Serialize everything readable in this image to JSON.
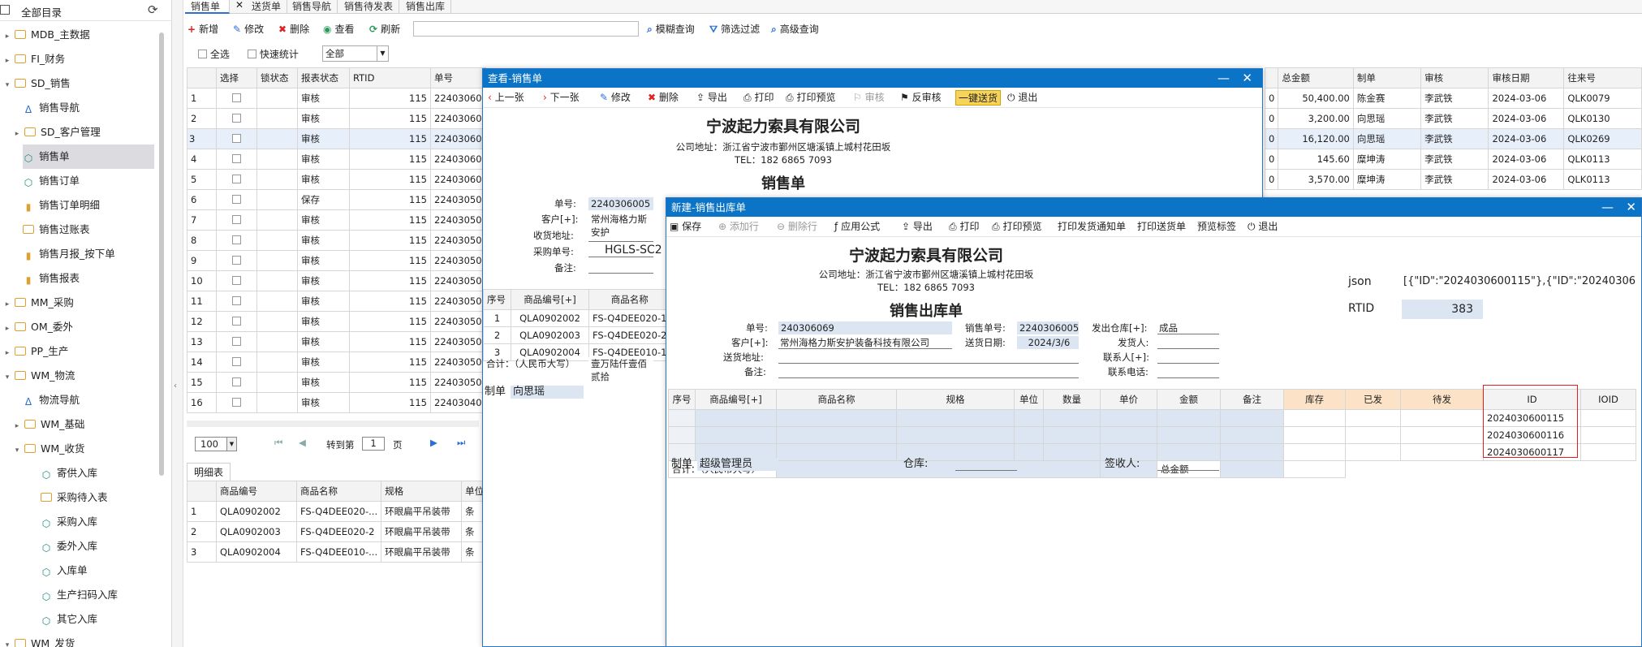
{
  "sidebar": {
    "title": "全部目录",
    "items": [
      {
        "label": "MDB_主数据",
        "icon": "folder",
        "arrow": "▸"
      },
      {
        "label": "FI_财务",
        "icon": "folder",
        "arrow": "▸"
      },
      {
        "label": "SD_销售",
        "icon": "folder",
        "arrow": "▾"
      },
      {
        "label": "销售导航",
        "icon": "triangle"
      },
      {
        "label": "SD_客户管理",
        "icon": "folder",
        "arrow": "▸"
      },
      {
        "label": "销售单",
        "icon": "cube",
        "selected": true
      },
      {
        "label": "销售订单",
        "icon": "cube"
      },
      {
        "label": "销售订单明细",
        "icon": "bar"
      },
      {
        "label": "销售过账表",
        "icon": "folder"
      },
      {
        "label": "销售月报_按下单",
        "icon": "bar"
      },
      {
        "label": "销售报表",
        "icon": "bar"
      },
      {
        "label": "MM_采购",
        "icon": "folder",
        "arrow": "▸"
      },
      {
        "label": "OM_委外",
        "icon": "folder",
        "arrow": "▸"
      },
      {
        "label": "PP_生产",
        "icon": "folder",
        "arrow": "▸"
      },
      {
        "label": "WM_物流",
        "icon": "folder",
        "arrow": "▾"
      },
      {
        "label": "物流导航",
        "icon": "triangle"
      },
      {
        "label": "WM_基础",
        "icon": "folder",
        "arrow": "▸"
      },
      {
        "label": "WM_收货",
        "icon": "folder",
        "arrow": "▾"
      },
      {
        "label": "寄供入库",
        "icon": "cube"
      },
      {
        "label": "采购待入表",
        "icon": "folder"
      },
      {
        "label": "采购入库",
        "icon": "cube"
      },
      {
        "label": "委外入库",
        "icon": "cube"
      },
      {
        "label": "入库单",
        "icon": "cube"
      },
      {
        "label": "生产扫码入库",
        "icon": "cube"
      },
      {
        "label": "其它入库",
        "icon": "cube"
      },
      {
        "label": "WM_发货",
        "icon": "folder",
        "arrow": "▾"
      }
    ]
  },
  "tabs": [
    "销售单",
    "送货单",
    "销售导航",
    "销售待发表",
    "销售出库"
  ],
  "toolbar": {
    "add": "新增",
    "edit": "修改",
    "delete": "删除",
    "view": "查看",
    "refresh": "刷新",
    "fuzzy": "模糊查询",
    "filter": "筛选过滤",
    "advanced": "高级查询",
    "select_all": "全选",
    "quick_stats": "快速统计",
    "scope": "全部"
  },
  "grid": {
    "headers": [
      "选择",
      "锁状态",
      "报表状态",
      "RTID",
      "单号"
    ],
    "rows": [
      {
        "n": "1",
        "status": "审核",
        "rtid": "115",
        "no": "22403060"
      },
      {
        "n": "2",
        "status": "审核",
        "rtid": "115",
        "no": "22403060"
      },
      {
        "n": "3",
        "status": "审核",
        "rtid": "115",
        "no": "22403060"
      },
      {
        "n": "4",
        "status": "审核",
        "rtid": "115",
        "no": "22403060"
      },
      {
        "n": "5",
        "status": "审核",
        "rtid": "115",
        "no": "22403060"
      },
      {
        "n": "6",
        "status": "保存",
        "rtid": "115",
        "no": "22403050"
      },
      {
        "n": "7",
        "status": "审核",
        "rtid": "115",
        "no": "22403050"
      },
      {
        "n": "8",
        "status": "审核",
        "rtid": "115",
        "no": "22403050"
      },
      {
        "n": "9",
        "status": "审核",
        "rtid": "115",
        "no": "22403050"
      },
      {
        "n": "10",
        "status": "审核",
        "rtid": "115",
        "no": "22403050"
      },
      {
        "n": "11",
        "status": "审核",
        "rtid": "115",
        "no": "22403050"
      },
      {
        "n": "12",
        "status": "审核",
        "rtid": "115",
        "no": "22403050"
      },
      {
        "n": "13",
        "status": "审核",
        "rtid": "115",
        "no": "22403050"
      },
      {
        "n": "14",
        "status": "审核",
        "rtid": "115",
        "no": "22403050"
      },
      {
        "n": "15",
        "status": "审核",
        "rtid": "115",
        "no": "22403050"
      },
      {
        "n": "16",
        "status": "审核",
        "rtid": "115",
        "no": "22403040"
      }
    ]
  },
  "right_grid": {
    "headers": [
      "总金额",
      "制单",
      "审核",
      "审核日期",
      "往来号"
    ],
    "rows": [
      {
        "amt": "50,400.00",
        "maker": "陈金赛",
        "auditor": "李武铁",
        "date": "2024-03-06",
        "ref": "QLK0079"
      },
      {
        "amt": "3,200.00",
        "maker": "向思瑶",
        "auditor": "李武铁",
        "date": "2024-03-06",
        "ref": "QLK0130"
      },
      {
        "amt": "16,120.00",
        "maker": "向思瑶",
        "auditor": "李武铁",
        "date": "2024-03-06",
        "ref": "QLK0269"
      },
      {
        "amt": "145.60",
        "maker": "糜坤涛",
        "auditor": "李武铁",
        "date": "2024-03-06",
        "ref": "QLK0113"
      },
      {
        "amt": "3,570.00",
        "maker": "糜坤涛",
        "auditor": "李武铁",
        "date": "2024-03-06",
        "ref": "QLK0113"
      }
    ]
  },
  "pager": {
    "size": "100",
    "goto": "转到第",
    "page": "1",
    "unit": "页"
  },
  "detail": {
    "tab": "明细表",
    "headers": [
      "商品编号",
      "商品名称",
      "规格",
      "单位"
    ],
    "rows": [
      {
        "n": "1",
        "code": "QLA0902002",
        "name": "FS-Q4DEE020-...",
        "spec": "环眼扁平吊装带",
        "unit": "条"
      },
      {
        "n": "2",
        "code": "QLA0902003",
        "name": "FS-Q4DEE020-2",
        "spec": "环眼扁平吊装带",
        "unit": "条"
      },
      {
        "n": "3",
        "code": "QLA0902004",
        "name": "FS-Q4DEE010-...",
        "spec": "环眼扁平吊装带",
        "unit": "条"
      }
    ]
  },
  "view_win": {
    "title": "查看-销售单",
    "toolbar": [
      "上一张",
      "下一张",
      "修改",
      "删除",
      "导出",
      "打印",
      "打印预览",
      "审核",
      "反审核",
      "一键送货",
      "退出"
    ],
    "company": "宁波起力索具有限公司",
    "address": "公司地址：浙江省宁波市鄞州区塘溪镇上城村花田坂",
    "tel": "TEL：182 6865 7093",
    "doc_title": "销售单",
    "labels": {
      "no": "单号:",
      "customer": "客户[+]:",
      "addr": "收货地址:",
      "po": "采购单号:",
      "note": "备注:",
      "maker": "制单"
    },
    "values": {
      "no": "2240306005",
      "customer": "常州海格力斯安护",
      "po": "HGLS-SC2",
      "maker": "向思瑶"
    },
    "lines_headers": [
      "序号",
      "商品编号[+]",
      "商品名称"
    ],
    "lines": [
      {
        "n": "1",
        "code": "QLA0902002",
        "name": "FS-Q4DEE020-1"
      },
      {
        "n": "2",
        "code": "QLA0902003",
        "name": "FS-Q4DEE020-2"
      },
      {
        "n": "3",
        "code": "QLA0902004",
        "name": "FS-Q4DEE010-1"
      }
    ],
    "total_label": "合计：（人民币大写）",
    "total_words": "壹万陆仟壹佰贰拾"
  },
  "new_win": {
    "title": "新建-销售出库单",
    "toolbar": [
      "保存",
      "添加行",
      "删除行",
      "应用公式",
      "导出",
      "打印",
      "打印预览",
      "打印发货通知单",
      "打印送货单",
      "预览标签",
      "退出"
    ],
    "company": "宁波起力索具有限公司",
    "address": "公司地址：浙江省宁波市鄞州区塘溪镇上城村花田坂",
    "tel": "TEL：182 6865 7093",
    "doc_title": "销售出库单",
    "json_label": "json",
    "json_value": "[{\"ID\":\"2024030600115\"},{\"ID\":\"20240306",
    "rtid_label": "RTID",
    "rtid_value": "383",
    "labels": {
      "no": "单号:",
      "sales_no": "销售单号:",
      "warehouse": "发出仓库[+]:",
      "customer": "客户[+]:",
      "date": "送货日期:",
      "shipper": "发货人:",
      "addr": "送货地址:",
      "contact": "联系人[+]:",
      "note": "备注:",
      "phone": "联系电话:",
      "maker": "制单",
      "store": "仓库:",
      "receiver": "签收人:"
    },
    "values": {
      "no": "240306069",
      "sales_no": "2240306005",
      "warehouse": "成品",
      "customer": "常州海格力斯安护装备科技有限公司",
      "date": "2024/3/6",
      "maker": "超级管理员"
    },
    "headers": [
      "序号",
      "商品编号[+]",
      "商品名称",
      "规格",
      "单位",
      "数量",
      "单价",
      "金额",
      "备注",
      "库存",
      "已发",
      "待发",
      "ID",
      "IOID"
    ],
    "ids": [
      "2024030600115",
      "2024030600116",
      "2024030600117"
    ],
    "total_label": "合计：（人民币大写）",
    "total_amount_label": "总金额"
  }
}
